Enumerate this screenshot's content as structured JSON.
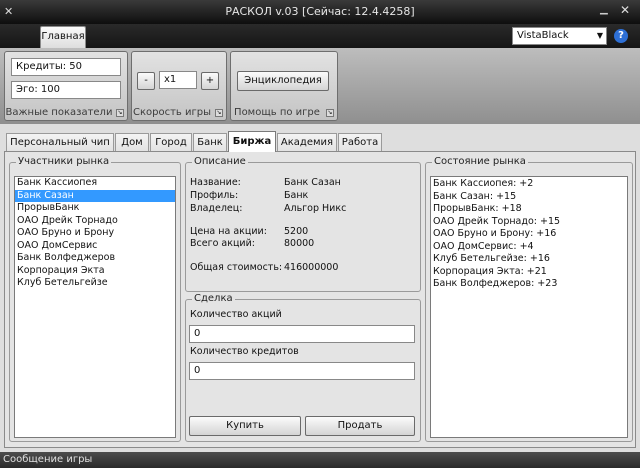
{
  "window": {
    "title": "РАСКОЛ v.03 [Сейчас: 12.4.4258]"
  },
  "ribbon": {
    "tab_main": "Главная",
    "theme": "VistaBlack",
    "key_stats": {
      "credits": "Кредиты: 50",
      "ego": "Эго: 100",
      "label": "Важные показатели"
    },
    "speed": {
      "minus": "-",
      "value": "x1",
      "plus": "+",
      "label": "Скорость игры"
    },
    "help": {
      "encyclopedia": "Энциклопедия",
      "label": "Помощь по игре"
    }
  },
  "tabs": [
    {
      "label": "Персональный чип"
    },
    {
      "label": "Дом"
    },
    {
      "label": "Город"
    },
    {
      "label": "Банк"
    },
    {
      "label": "Биржа"
    },
    {
      "label": "Академия"
    },
    {
      "label": "Работа"
    }
  ],
  "market_participants": {
    "title": "Участники рынка",
    "items": [
      "Банк Кассиопея",
      "Банк Сазан",
      "ПрорывБанк",
      "ОАО Дрейк Торнадо",
      "ОАО Бруно и Брону",
      "ОАО ДомСервис",
      "Банк Волфеджеров",
      "Корпорация Экта",
      "Клуб Бетельгейзе"
    ],
    "selected_index": 1
  },
  "description": {
    "title": "Описание",
    "name_label": "Название:",
    "name_value": "Банк Сазан",
    "profile_label": "Профиль:",
    "profile_value": "Банк",
    "owner_label": "Владелец:",
    "owner_value": "Альгор Никс",
    "price_label": "Цена на акции:",
    "price_value": "5200",
    "total_label": "Всего акций:",
    "total_value": "80000",
    "cost_label": "Общая стоимость:",
    "cost_value": "416000000"
  },
  "deal": {
    "title": "Сделка",
    "shares_label": "Количество акций",
    "shares_value": "0",
    "credits_label": "Количество кредитов",
    "credits_value": "0",
    "buy": "Купить",
    "sell": "Продать"
  },
  "market_state": {
    "title": "Состояние рынка",
    "items": [
      "Банк Кассиопея: +2",
      "Банк Сазан: +15",
      "ПрорывБанк: +18",
      "ОАО Дрейк Торнадо: +15",
      "ОАО Бруно и Брону: +16",
      "ОАО ДомСервис: +4",
      "Клуб Бетельгейзе: +16",
      "Корпорация Экта: +21",
      "Банк Волфеджеров: +23"
    ]
  },
  "status": {
    "message": "Сообщение игры"
  }
}
